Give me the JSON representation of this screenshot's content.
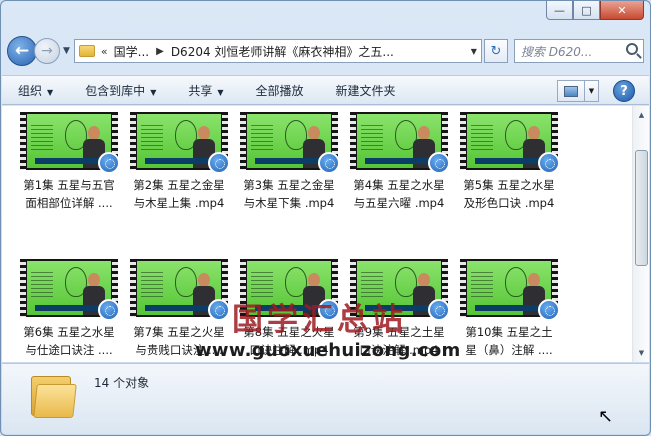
{
  "window": {
    "minimize_glyph": "—",
    "maximize_glyph": "□",
    "close_glyph": "✕"
  },
  "nav": {
    "back_glyph": "←",
    "forward_glyph": "→",
    "address_chevron": "«",
    "breadcrumb": [
      "国学...",
      "D6204 刘恒老师讲解《麻衣神相》之五..."
    ],
    "refresh_glyph": "↻",
    "search_placeholder": "搜索 D620..."
  },
  "toolbar": {
    "organize": "组织",
    "include_in_library": "包含到库中",
    "share": "共享",
    "play_all": "全部播放",
    "new_folder": "新建文件夹",
    "help_glyph": "?"
  },
  "files": [
    {
      "line1": "第1集 五星与五官",
      "line2": "面相部位详解 ...."
    },
    {
      "line1": "第2集 五星之金星",
      "line2": "与木星上集 .mp4"
    },
    {
      "line1": "第3集 五星之金星",
      "line2": "与木星下集 .mp4"
    },
    {
      "line1": "第4集 五星之水星",
      "line2": "与五星六曜 .mp4"
    },
    {
      "line1": "第5集 五星之水星",
      "line2": "及形色口诀 .mp4"
    },
    {
      "line1": "第6集 五星之水星",
      "line2": "与仕途口诀注 ...."
    },
    {
      "line1": "第7集 五星之火星",
      "line2": "与贵贱口诀注 ...."
    },
    {
      "line1": "第8集 五星之火星",
      "line2": "口诀注解 .mp4"
    },
    {
      "line1": "第9集 五星之土星",
      "line2": "口诀注解 .mp4"
    },
    {
      "line1": "第10集 五星之土",
      "line2": "星（鼻）注解 ...."
    }
  ],
  "watermark": {
    "title": "国学汇总站",
    "url": "www.guoxuehuizong.com"
  },
  "details": {
    "item_count": "14 个对象"
  },
  "colors": {
    "accent": "#2a63b3",
    "thumbnail_green": "#6fd64f",
    "watermark_red": "#9e1b21"
  }
}
